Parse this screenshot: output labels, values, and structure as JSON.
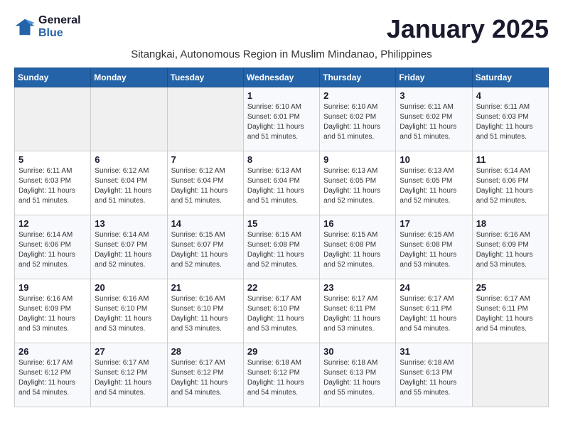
{
  "header": {
    "logo_line1": "General",
    "logo_line2": "Blue",
    "month": "January 2025",
    "subtitle": "Sitangkai, Autonomous Region in Muslim Mindanao, Philippines"
  },
  "days_of_week": [
    "Sunday",
    "Monday",
    "Tuesday",
    "Wednesday",
    "Thursday",
    "Friday",
    "Saturday"
  ],
  "weeks": [
    [
      {
        "num": "",
        "info": ""
      },
      {
        "num": "",
        "info": ""
      },
      {
        "num": "",
        "info": ""
      },
      {
        "num": "1",
        "info": "Sunrise: 6:10 AM\nSunset: 6:01 PM\nDaylight: 11 hours\nand 51 minutes."
      },
      {
        "num": "2",
        "info": "Sunrise: 6:10 AM\nSunset: 6:02 PM\nDaylight: 11 hours\nand 51 minutes."
      },
      {
        "num": "3",
        "info": "Sunrise: 6:11 AM\nSunset: 6:02 PM\nDaylight: 11 hours\nand 51 minutes."
      },
      {
        "num": "4",
        "info": "Sunrise: 6:11 AM\nSunset: 6:03 PM\nDaylight: 11 hours\nand 51 minutes."
      }
    ],
    [
      {
        "num": "5",
        "info": "Sunrise: 6:11 AM\nSunset: 6:03 PM\nDaylight: 11 hours\nand 51 minutes."
      },
      {
        "num": "6",
        "info": "Sunrise: 6:12 AM\nSunset: 6:04 PM\nDaylight: 11 hours\nand 51 minutes."
      },
      {
        "num": "7",
        "info": "Sunrise: 6:12 AM\nSunset: 6:04 PM\nDaylight: 11 hours\nand 51 minutes."
      },
      {
        "num": "8",
        "info": "Sunrise: 6:13 AM\nSunset: 6:04 PM\nDaylight: 11 hours\nand 51 minutes."
      },
      {
        "num": "9",
        "info": "Sunrise: 6:13 AM\nSunset: 6:05 PM\nDaylight: 11 hours\nand 52 minutes."
      },
      {
        "num": "10",
        "info": "Sunrise: 6:13 AM\nSunset: 6:05 PM\nDaylight: 11 hours\nand 52 minutes."
      },
      {
        "num": "11",
        "info": "Sunrise: 6:14 AM\nSunset: 6:06 PM\nDaylight: 11 hours\nand 52 minutes."
      }
    ],
    [
      {
        "num": "12",
        "info": "Sunrise: 6:14 AM\nSunset: 6:06 PM\nDaylight: 11 hours\nand 52 minutes."
      },
      {
        "num": "13",
        "info": "Sunrise: 6:14 AM\nSunset: 6:07 PM\nDaylight: 11 hours\nand 52 minutes."
      },
      {
        "num": "14",
        "info": "Sunrise: 6:15 AM\nSunset: 6:07 PM\nDaylight: 11 hours\nand 52 minutes."
      },
      {
        "num": "15",
        "info": "Sunrise: 6:15 AM\nSunset: 6:08 PM\nDaylight: 11 hours\nand 52 minutes."
      },
      {
        "num": "16",
        "info": "Sunrise: 6:15 AM\nSunset: 6:08 PM\nDaylight: 11 hours\nand 52 minutes."
      },
      {
        "num": "17",
        "info": "Sunrise: 6:15 AM\nSunset: 6:08 PM\nDaylight: 11 hours\nand 53 minutes."
      },
      {
        "num": "18",
        "info": "Sunrise: 6:16 AM\nSunset: 6:09 PM\nDaylight: 11 hours\nand 53 minutes."
      }
    ],
    [
      {
        "num": "19",
        "info": "Sunrise: 6:16 AM\nSunset: 6:09 PM\nDaylight: 11 hours\nand 53 minutes."
      },
      {
        "num": "20",
        "info": "Sunrise: 6:16 AM\nSunset: 6:10 PM\nDaylight: 11 hours\nand 53 minutes."
      },
      {
        "num": "21",
        "info": "Sunrise: 6:16 AM\nSunset: 6:10 PM\nDaylight: 11 hours\nand 53 minutes."
      },
      {
        "num": "22",
        "info": "Sunrise: 6:17 AM\nSunset: 6:10 PM\nDaylight: 11 hours\nand 53 minutes."
      },
      {
        "num": "23",
        "info": "Sunrise: 6:17 AM\nSunset: 6:11 PM\nDaylight: 11 hours\nand 53 minutes."
      },
      {
        "num": "24",
        "info": "Sunrise: 6:17 AM\nSunset: 6:11 PM\nDaylight: 11 hours\nand 54 minutes."
      },
      {
        "num": "25",
        "info": "Sunrise: 6:17 AM\nSunset: 6:11 PM\nDaylight: 11 hours\nand 54 minutes."
      }
    ],
    [
      {
        "num": "26",
        "info": "Sunrise: 6:17 AM\nSunset: 6:12 PM\nDaylight: 11 hours\nand 54 minutes."
      },
      {
        "num": "27",
        "info": "Sunrise: 6:17 AM\nSunset: 6:12 PM\nDaylight: 11 hours\nand 54 minutes."
      },
      {
        "num": "28",
        "info": "Sunrise: 6:17 AM\nSunset: 6:12 PM\nDaylight: 11 hours\nand 54 minutes."
      },
      {
        "num": "29",
        "info": "Sunrise: 6:18 AM\nSunset: 6:12 PM\nDaylight: 11 hours\nand 54 minutes."
      },
      {
        "num": "30",
        "info": "Sunrise: 6:18 AM\nSunset: 6:13 PM\nDaylight: 11 hours\nand 55 minutes."
      },
      {
        "num": "31",
        "info": "Sunrise: 6:18 AM\nSunset: 6:13 PM\nDaylight: 11 hours\nand 55 minutes."
      },
      {
        "num": "",
        "info": ""
      }
    ]
  ]
}
